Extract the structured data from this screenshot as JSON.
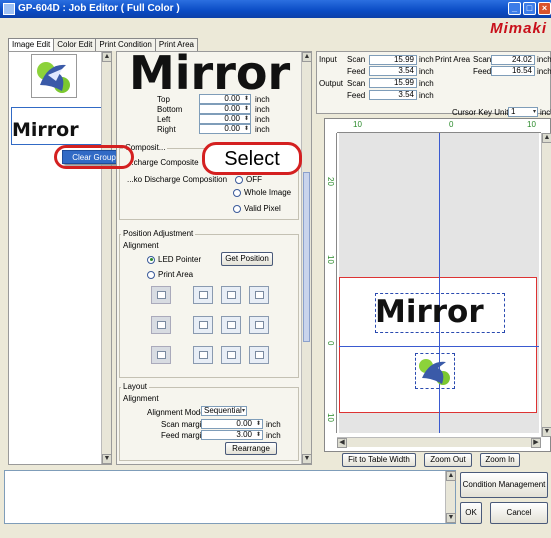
{
  "window": {
    "title": "GP-604D : Job Editor ( Full Color )",
    "logo": "Mimaki"
  },
  "tabs": [
    "Image Edit",
    "Color Edit",
    "Print Condition",
    "Print Area"
  ],
  "thumbnails": {
    "text_item": "Mirror"
  },
  "context_menu": {
    "item": "Clear Group"
  },
  "callout": {
    "label": "Select"
  },
  "preview_text": "Mirror",
  "margins": {
    "top_label": "Top",
    "top": "0.00",
    "bottom_label": "Bottom",
    "bottom": "0.00",
    "left_label": "Left",
    "left": "0.00",
    "right_label": "Right",
    "right": "0.00",
    "unit": "inch"
  },
  "composite": {
    "group_title": "Composit...",
    "discharge_label": "...charge Composite",
    "raw_label": "...ko Discharge Composition",
    "off_label": "OFF",
    "whole_image": "Whole Image",
    "valid_pixel": "Valid Pixel"
  },
  "position": {
    "title": "Position Adjustment",
    "alignment": "Alignment",
    "led_pointer": "LED Pointer",
    "get_position": "Get Position",
    "print_area": "Print Area"
  },
  "layout": {
    "title": "Layout",
    "alignment": "Alignment",
    "mode_label": "Alignment Mode",
    "mode_value": "Sequential",
    "scan_label": "Scan margin",
    "scan_value": "0.00",
    "feed_label": "Feed margin",
    "feed_value": "3.00",
    "unit": "inch",
    "rearrange": "Rearrange"
  },
  "info": {
    "input_label": "Input",
    "scan_label": "Scan",
    "feed_label": "Feed",
    "output_label": "Output",
    "unit": "inch",
    "input_scan": "15.99",
    "input_feed": "3.54",
    "output_scan": "15.99",
    "output_feed": "3.54",
    "print_area_label": "Print Area",
    "pa_scan": "24.02",
    "pa_feed": "16.54"
  },
  "cursor": {
    "label": "Cursor Key Unit",
    "value": "1",
    "unit": "inch"
  },
  "ruler": {
    "top_labels": [
      "10",
      "0",
      "10"
    ],
    "left_labels": [
      "20",
      "10",
      "0",
      "10"
    ]
  },
  "canvas_text": "Mirror",
  "bottom_buttons": {
    "fit": "Fit to Table Width",
    "zoom_out": "Zoom Out",
    "zoom_in": "Zoom In"
  },
  "footer_buttons": {
    "condition": "Condition Management",
    "ok": "OK",
    "cancel": "Cancel"
  },
  "colors": {
    "accent": "#d42020",
    "title_bar": "#0a4bc4",
    "highlight": "#316ac5"
  }
}
